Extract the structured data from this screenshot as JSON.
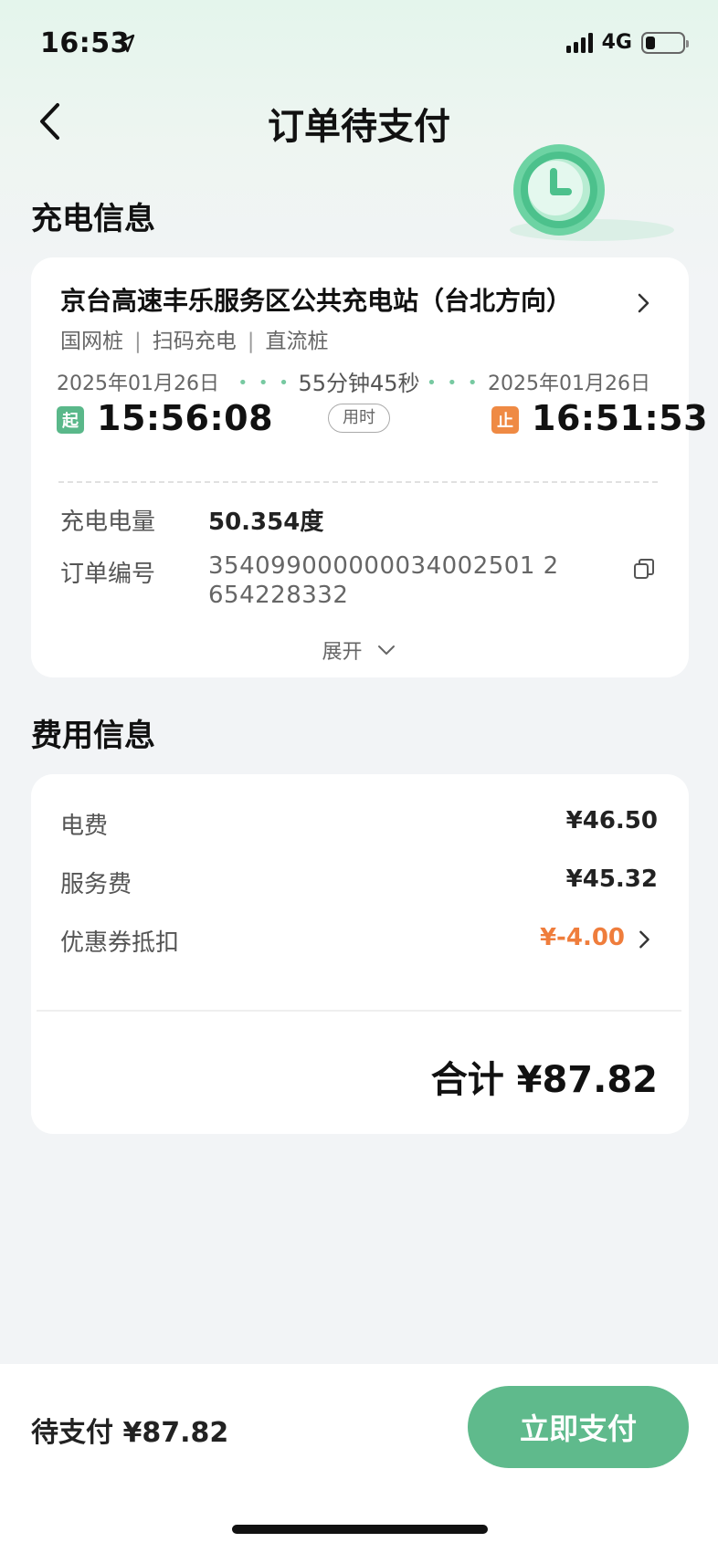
{
  "status_bar": {
    "time": "16:53",
    "network": "4G"
  },
  "nav": {
    "title": "订单待支付"
  },
  "charge_section": {
    "title": "充电信息",
    "station_name": "京台高速丰乐服务区公共充电站（台北方向）",
    "tags": [
      "国网桩",
      "扫码充电",
      "直流桩"
    ],
    "start_date": "2025年01月26日",
    "start_badge": "起",
    "start_time": "15:56:08",
    "duration": "55分钟45秒",
    "duration_label": "用时",
    "end_date": "2025年01月26日",
    "end_badge": "止",
    "end_time": "16:51:53",
    "energy_label": "充电电量",
    "energy_value": "50.354度",
    "order_label": "订单编号",
    "order_no_line1": "354099000000034002501 2",
    "order_no_line2": "654228332",
    "expand_label": "展开"
  },
  "fee_section": {
    "title": "费用信息",
    "items": [
      {
        "label": "电费",
        "value": "¥46.50"
      },
      {
        "label": "服务费",
        "value": "¥45.32"
      },
      {
        "label": "优惠券抵扣",
        "value": "¥-4.00"
      }
    ],
    "total": "合计 ¥87.82"
  },
  "bottom_bar": {
    "pending": "待支付 ¥87.82",
    "pay_button": "立即支付"
  },
  "colors": {
    "accent_green": "#5fba8c",
    "coupon_orange": "#ef7d3c",
    "stop_orange": "#ef8a44"
  }
}
